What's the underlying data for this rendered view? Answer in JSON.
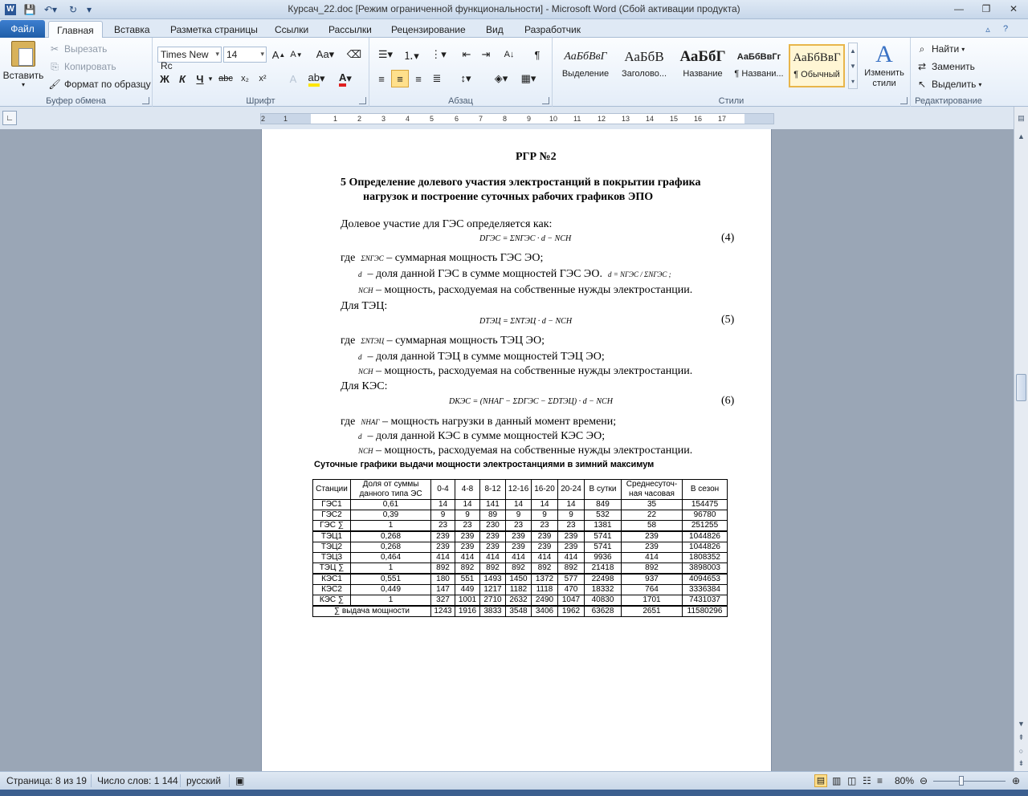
{
  "window": {
    "title": "Курсач_22.doc [Режим ограниченной функциональности]  -  Microsoft Word (Сбой активации продукта)"
  },
  "tabs": {
    "file": "Файл",
    "items": [
      "Главная",
      "Вставка",
      "Разметка страницы",
      "Ссылки",
      "Рассылки",
      "Рецензирование",
      "Вид",
      "Разработчик"
    ]
  },
  "ribbon": {
    "clipboard": {
      "label": "Буфер обмена",
      "paste": "Вставить",
      "cut": "Вырезать",
      "copy": "Копировать",
      "format_painter": "Формат по образцу"
    },
    "font": {
      "label": "Шрифт",
      "font_name": "Times New Rc",
      "font_size": "14"
    },
    "paragraph": {
      "label": "Абзац"
    },
    "styles": {
      "label": "Стили",
      "items": [
        {
          "sample": "АаБбВвГ",
          "name": "Выделение"
        },
        {
          "sample": "АаБбВ",
          "name": "Заголово..."
        },
        {
          "sample": "АаБбГ",
          "name": "Название"
        },
        {
          "sample": "АаБбВвГг",
          "name": "¶ Названи..."
        },
        {
          "sample": "АаБбВвГ",
          "name": "¶ Обычный"
        }
      ],
      "change_styles": "Изменить стили"
    },
    "editing": {
      "label": "Редактирование",
      "find": "Найти",
      "replace": "Заменить",
      "select": "Выделить"
    }
  },
  "ruler": {
    "ticks": [
      "2",
      "1",
      "1",
      "2",
      "3",
      "4",
      "5",
      "6",
      "7",
      "8",
      "9",
      "10",
      "11",
      "12",
      "13",
      "14",
      "15",
      "16",
      "17"
    ]
  },
  "document": {
    "heading": "РГР №2",
    "section_title_line1": "5 Определение долевого участия электростанций в покрытии графика",
    "section_title_line2": "нагрузок и построение суточных рабочих графиков ЭПО",
    "intro_ges": "Долевое участие для ГЭС определяется как:",
    "formula4": "DГЭС = ΣNГЭС · d − NСН",
    "eq4": "(4)",
    "where": "где",
    "ges_sum_sym": "ΣNГЭС",
    "ges_sum_text": "– суммарная мощность ГЭС ЭО;",
    "d_sym": "d",
    "ges_d_text": "– доля данной ГЭС в сумме мощностей ГЭС ЭО.",
    "ges_d_formula": "d = NГЭС / ΣNГЭС ;",
    "nsn_sym": "NСН",
    "nsn_text": "– мощность, расходуемая на собственные нужды электростанции.",
    "intro_tec": "Для ТЭЦ:",
    "formula5": "DТЭЦ = ΣNТЭЦ · d − NСН",
    "eq5": "(5)",
    "tec_sum_sym": "ΣNТЭЦ",
    "tec_sum_text": "– суммарная мощность ТЭЦ ЭО;",
    "tec_d_text": "– доля данной ТЭЦ в сумме мощностей ТЭЦ ЭО;",
    "intro_kes": "Для КЭС:",
    "formula6": "DКЭС = (NНАГ − ΣDГЭС − ΣDТЭЦ) · d − NСН",
    "eq6": "(6)",
    "nnag_sym": "NНАГ",
    "nnag_text": "– мощность нагрузки в данный момент времени;",
    "kes_d_text": "– доля данной КЭС в сумме мощностей КЭС ЭО;",
    "table_title": "Суточные графики выдачи мощности электростанциями в зимний максимум",
    "table": {
      "headers": [
        "Станции",
        "Доля от суммы данного типа ЭС",
        "0-4",
        "4-8",
        "8-12",
        "12-16",
        "16-20",
        "20-24",
        "В сутки",
        "Среднесуточ-ная часовая",
        "В сезон"
      ],
      "rows": [
        [
          "ГЭС1",
          "0,61",
          "14",
          "14",
          "141",
          "14",
          "14",
          "14",
          "849",
          "35",
          "154475"
        ],
        [
          "ГЭС2",
          "0,39",
          "9",
          "9",
          "89",
          "9",
          "9",
          "9",
          "532",
          "22",
          "96780"
        ],
        [
          "ГЭС ∑",
          "1",
          "23",
          "23",
          "230",
          "23",
          "23",
          "23",
          "1381",
          "58",
          "251255"
        ],
        [
          "ТЭЦ1",
          "0,268",
          "239",
          "239",
          "239",
          "239",
          "239",
          "239",
          "5741",
          "239",
          "1044826"
        ],
        [
          "ТЭЦ2",
          "0,268",
          "239",
          "239",
          "239",
          "239",
          "239",
          "239",
          "5741",
          "239",
          "1044826"
        ],
        [
          "ТЭЦ3",
          "0,464",
          "414",
          "414",
          "414",
          "414",
          "414",
          "414",
          "9936",
          "414",
          "1808352"
        ],
        [
          "ТЭЦ ∑",
          "1",
          "892",
          "892",
          "892",
          "892",
          "892",
          "892",
          "21418",
          "892",
          "3898003"
        ],
        [
          "КЭС1",
          "0,551",
          "180",
          "551",
          "1493",
          "1450",
          "1372",
          "577",
          "22498",
          "937",
          "4094653"
        ],
        [
          "КЭС2",
          "0,449",
          "147",
          "449",
          "1217",
          "1182",
          "1118",
          "470",
          "18332",
          "764",
          "3336384"
        ],
        [
          "КЭС ∑",
          "1",
          "327",
          "1001",
          "2710",
          "2632",
          "2490",
          "1047",
          "40830",
          "1701",
          "7431037"
        ],
        [
          "∑ выдача мощности",
          "",
          "1243",
          "1916",
          "3833",
          "3548",
          "3406",
          "1962",
          "63628",
          "2651",
          "11580296"
        ]
      ]
    }
  },
  "status": {
    "page": "Страница: 8 из 19",
    "words": "Число слов: 1 144",
    "language": "русский",
    "zoom": "80%",
    "zoom_level_percent": 80
  }
}
